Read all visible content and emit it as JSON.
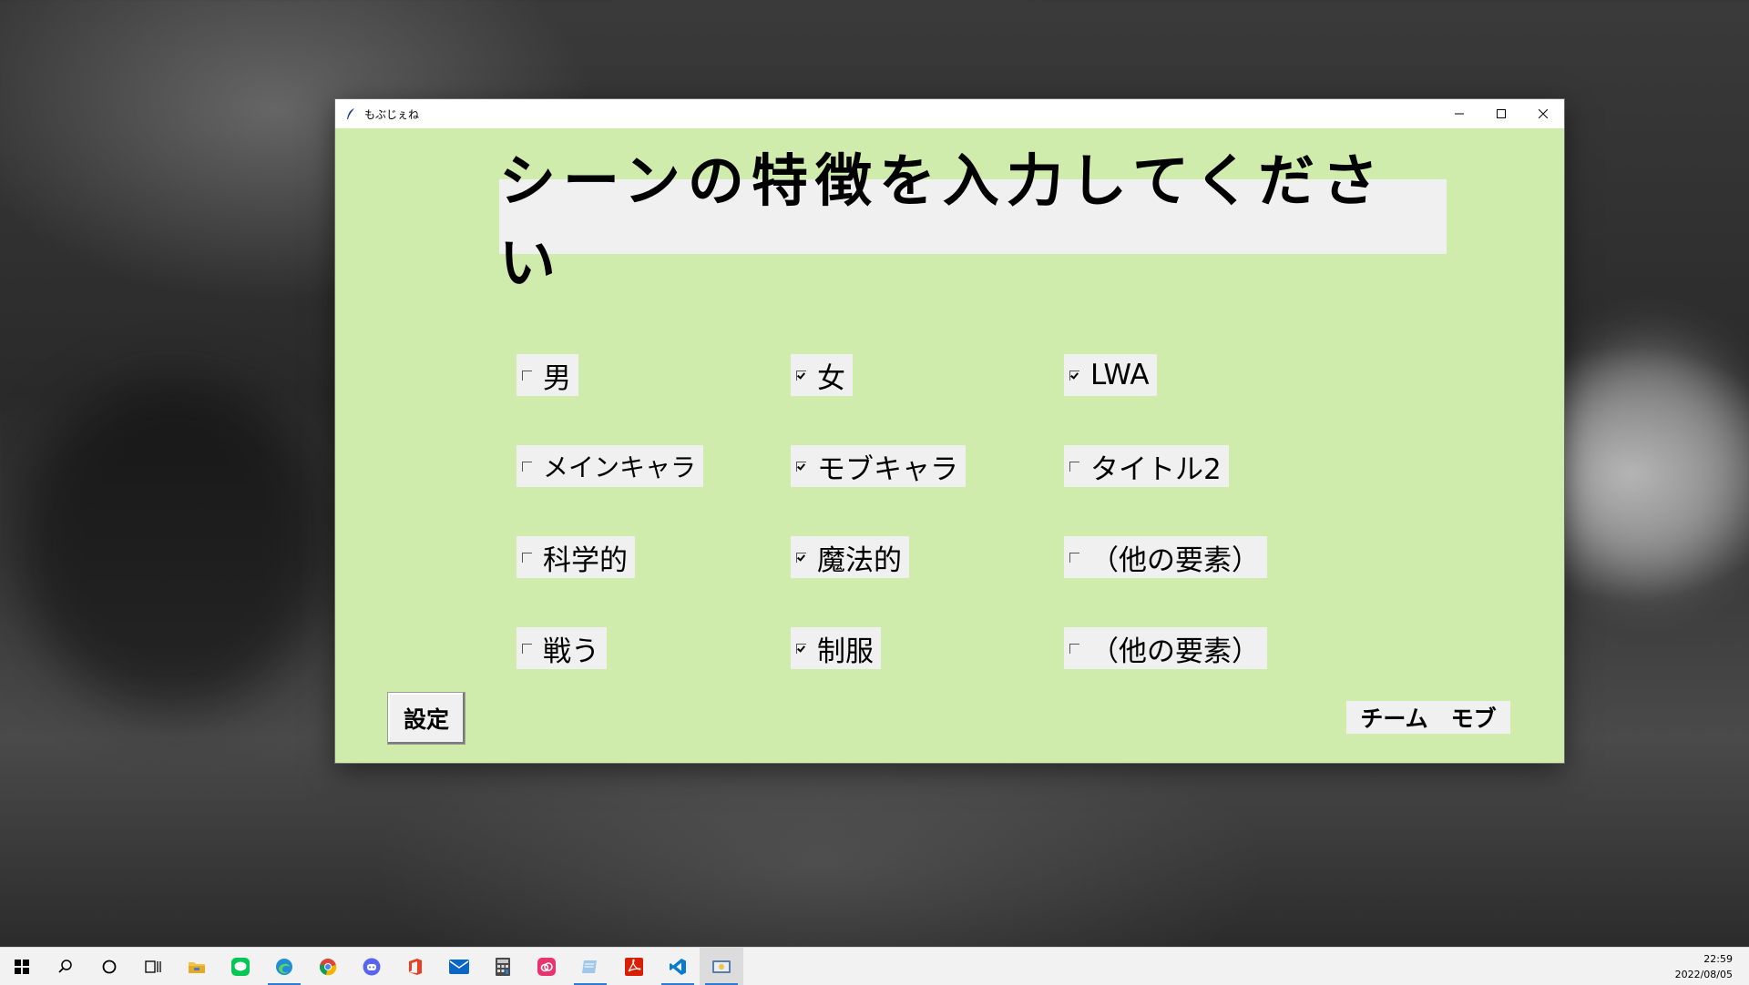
{
  "window": {
    "title": "もぶじぇね",
    "heading": "シーンの特徴を入力してください",
    "checkboxes": [
      {
        "label": "男",
        "checked": false
      },
      {
        "label": "女",
        "checked": true
      },
      {
        "label": "LWA",
        "checked": true
      },
      {
        "label": "メインキャラ",
        "checked": false
      },
      {
        "label": "モブキャラ",
        "checked": true
      },
      {
        "label": "タイトル2",
        "checked": false
      },
      {
        "label": "科学的",
        "checked": false
      },
      {
        "label": "魔法的",
        "checked": true
      },
      {
        "label": "（他の要素）",
        "checked": false
      },
      {
        "label": "戦う",
        "checked": false
      },
      {
        "label": "制服",
        "checked": true
      },
      {
        "label": "（他の要素）",
        "checked": false
      }
    ],
    "settings_button": "設定",
    "credit": "チーム　モブ"
  },
  "taskbar": {
    "items": [
      "windows-start-icon",
      "search-icon",
      "cortana-icon",
      "task-view-icon",
      "file-explorer-icon",
      "line-icon",
      "edge-icon",
      "chrome-icon",
      "discord-icon",
      "office-icon",
      "mail-icon",
      "calculator-icon",
      "creative-cloud-icon",
      "notepad-icon",
      "acrobat-icon",
      "vscode-icon",
      "python-icon"
    ],
    "active_items": [
      "edge-icon",
      "notepad-icon",
      "vscode-icon",
      "python-icon"
    ],
    "time": "22:59",
    "date": "2022/08/05"
  },
  "colors": {
    "window_bg": "#d0ecac",
    "widget_bg": "#f0f0f0",
    "taskbar_accent": "#2b7cd3"
  }
}
